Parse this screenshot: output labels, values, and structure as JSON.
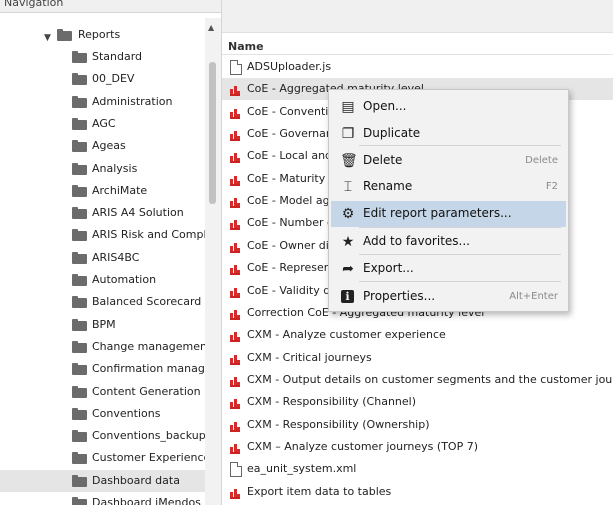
{
  "navigation": {
    "title": "Navigation",
    "root": {
      "label": "Reports",
      "expanded": true
    },
    "folders": [
      "Standard",
      "00_DEV",
      "Administration",
      "AGC",
      "Ageas",
      "Analysis",
      "ArchiMate",
      "ARIS A4 Solution",
      "ARIS Risk and Complian",
      "ARIS4BC",
      "Automation",
      "Balanced Scorecard",
      "BPM",
      "Change management",
      "Confirmation manager",
      "Content Generation",
      "Conventions",
      "Conventions_backup",
      "Customer Experience M",
      "Dashboard data",
      "Dashboard iMendos"
    ],
    "selected_folder": "Dashboard data"
  },
  "list": {
    "column_header": "Name",
    "items": [
      {
        "type": "doc",
        "name": "ADSUploader.js"
      },
      {
        "type": "report",
        "name": "CoE - Aggregated maturity level"
      },
      {
        "type": "report",
        "name": "CoE - Convention"
      },
      {
        "type": "report",
        "name": "CoE - Governance"
      },
      {
        "type": "report",
        "name": "CoE - Local and g"
      },
      {
        "type": "report",
        "name": "CoE - Maturity lev"
      },
      {
        "type": "report",
        "name": "CoE - Model age"
      },
      {
        "type": "report",
        "name": "CoE - Number of"
      },
      {
        "type": "report",
        "name": "CoE - Owner distr"
      },
      {
        "type": "report",
        "name": "CoE - Representa"
      },
      {
        "type": "report",
        "name": "CoE - Validity dat"
      },
      {
        "type": "report",
        "name": "Correction CoE - Aggregated maturity level"
      },
      {
        "type": "report",
        "name": "CXM - Analyze customer experience"
      },
      {
        "type": "report",
        "name": "CXM - Critical journeys"
      },
      {
        "type": "report",
        "name": "CXM - Output details on customer segments and the customer journeys as"
      },
      {
        "type": "report",
        "name": "CXM - Responsibility (Channel)"
      },
      {
        "type": "report",
        "name": "CXM - Responsibility (Ownership)"
      },
      {
        "type": "report",
        "name": "CXM – Analyze customer journeys (TOP 7)"
      },
      {
        "type": "doc",
        "name": "ea_unit_system.xml"
      },
      {
        "type": "report",
        "name": "Export item data to tables"
      }
    ]
  },
  "context_menu": {
    "items": [
      {
        "icon": "open-icon",
        "label": "Open...",
        "shortcut": ""
      },
      {
        "icon": "duplicate-icon",
        "label": "Duplicate",
        "shortcut": ""
      },
      {
        "icon": "trash-icon",
        "label": "Delete",
        "shortcut": "Delete"
      },
      {
        "icon": "rename-icon",
        "label": "Rename",
        "shortcut": "F2"
      },
      {
        "icon": "settings-icon",
        "label": "Edit report parameters...",
        "shortcut": "",
        "highlighted": true
      },
      {
        "icon": "star-icon",
        "label": "Add to favorites...",
        "shortcut": ""
      },
      {
        "icon": "export-icon",
        "label": "Export...",
        "shortcut": ""
      },
      {
        "icon": "info-icon",
        "label": "Properties...",
        "shortcut": "Alt+Enter"
      }
    ]
  },
  "colors": {
    "menu_highlight": "#c5d6e8",
    "report_icon": "#d62b2b",
    "folder_icon": "#6b6b6b",
    "selection": "#e5e5e5"
  }
}
